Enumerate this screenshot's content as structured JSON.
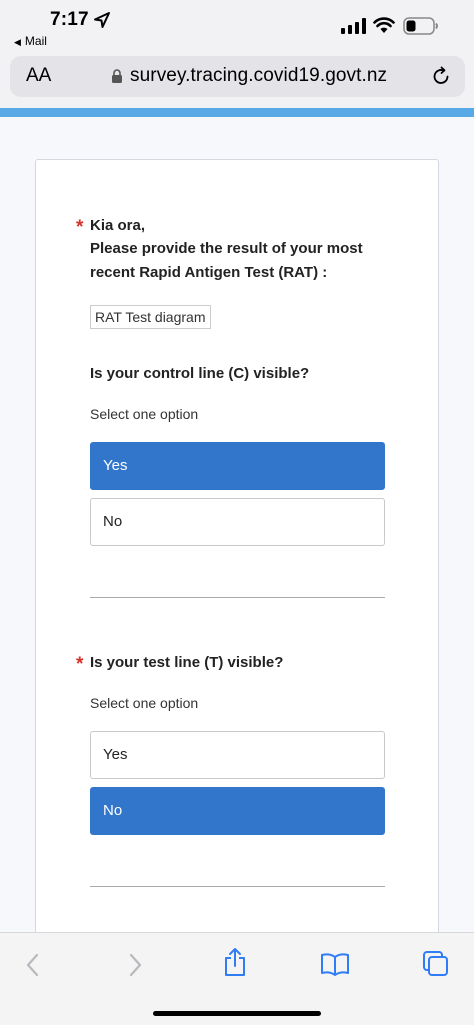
{
  "status_bar": {
    "time": "7:17",
    "back_app": "Mail"
  },
  "address_bar": {
    "aa_label": "AA",
    "url": "survey.tracing.covid19.govt.nz"
  },
  "form": {
    "intro": {
      "required_mark": "*",
      "greeting": "Kia ora,",
      "line1": "Please provide the result of your most",
      "line2": "recent Rapid Antigen Test (RAT) :"
    },
    "image_alt": "RAT Test diagram",
    "question1": {
      "label": "Is your control line (C) visible?",
      "hint": "Select one option",
      "options": [
        {
          "label": "Yes",
          "selected": true
        },
        {
          "label": "No",
          "selected": false
        }
      ]
    },
    "question2": {
      "required_mark": "*",
      "label": "Is your test line (T) visible?",
      "hint": "Select one option",
      "options": [
        {
          "label": "Yes",
          "selected": false
        },
        {
          "label": "No",
          "selected": true
        }
      ]
    }
  },
  "colors": {
    "accent": "#3276cc",
    "required": "#d5312a",
    "strip": "#58a9e6",
    "toolbar_icon": "#2f7cf6"
  },
  "toolbar_icons": [
    "back-icon",
    "forward-icon",
    "share-icon",
    "bookmarks-icon",
    "tabs-icon"
  ]
}
